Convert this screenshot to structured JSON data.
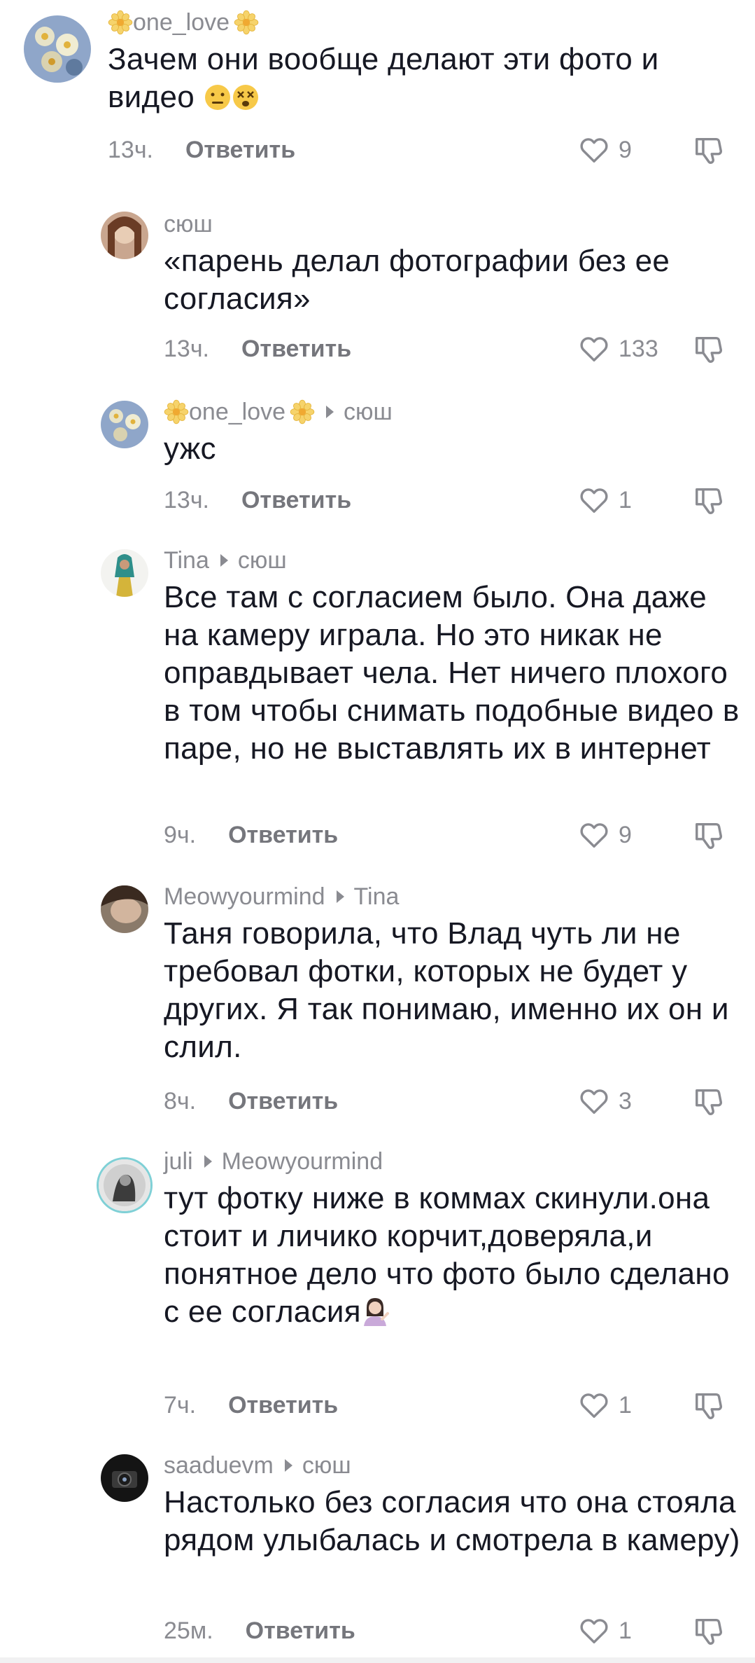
{
  "reply_label": "Ответить",
  "comments": [
    {
      "user": "one_love",
      "reply_to": "",
      "text": "Зачем они вообще делают эти фото и видео",
      "time": "13ч.",
      "likes": "9"
    },
    {
      "user": "сюш",
      "reply_to": "",
      "text": "«парень делал фотографии без ее согласия»",
      "time": "13ч.",
      "likes": "133"
    },
    {
      "user": "one_love",
      "reply_to": "сюш",
      "text": "ужс",
      "time": "13ч.",
      "likes": "1"
    },
    {
      "user": "Tina",
      "reply_to": "сюш",
      "text": "Все там с согласием было. Она даже на камеру играла. Но это никак не оправдывает чела. Нет ничего плохого в том чтобы снимать подобные видео в паре, но не выставлять их в интернет",
      "time": "9ч.",
      "likes": "9"
    },
    {
      "user": "Meowyourmind",
      "reply_to": "Tina",
      "text": "Таня говорила, что Влад чуть ли не требовал фотки, которых не будет у других. Я так понимаю, именно их он и слил.",
      "time": "8ч.",
      "likes": "3"
    },
    {
      "user": "juli",
      "reply_to": "Meowyourmind",
      "text": "тут фотку ниже в коммах скинули.она стоит и личико корчит,доверяла,и понятное дело что фото было сделано с ее согласия",
      "time": "7ч.",
      "likes": "1"
    },
    {
      "user": "saaduevm",
      "reply_to": "сюш",
      "text": "Настолько без согласия что она стояла рядом улыбалась и смотрела в камеру)",
      "time": "25м.",
      "likes": "1"
    }
  ]
}
